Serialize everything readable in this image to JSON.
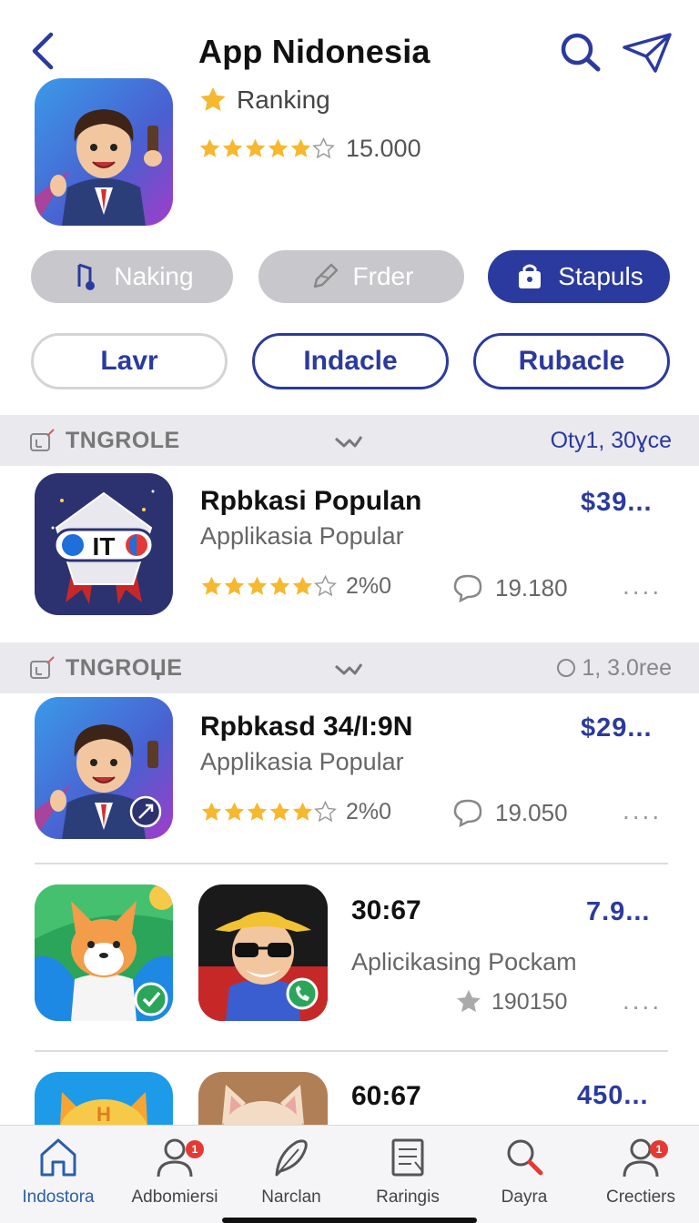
{
  "header": {
    "title": "App Nidonesia",
    "ranking_label": "Ranking",
    "rating_count": "15.000"
  },
  "filters_primary": [
    {
      "label": "Naking",
      "icon": "music-note-icon"
    },
    {
      "label": "Frder",
      "icon": "pen-icon"
    },
    {
      "label": "Stapuls",
      "icon": "bag-icon"
    }
  ],
  "filters_secondary": [
    {
      "label": "Lavr"
    },
    {
      "label": "Indacle"
    },
    {
      "label": "Rubacle"
    }
  ],
  "sections": [
    {
      "label": "TNGROLE",
      "right": "Oty1, 30ɣce"
    },
    {
      "label": "TNGROЏE",
      "right": "1, 3.0ree"
    }
  ],
  "items": [
    {
      "title": "Rpbkasi Populan",
      "subtitle": "Applikasia Popular",
      "price": "$39...",
      "rating": "2%0",
      "comments": "19.180",
      "more": "...."
    },
    {
      "title": "Rpbkasd 34/I:9N",
      "subtitle": "Applikasia  Popular",
      "price": "$29...",
      "rating": "2%0",
      "comments": "19.050",
      "more": "...."
    },
    {
      "title": "30:67",
      "subtitle": "Aplicikasing Pockam",
      "price": "7.9...",
      "count": "190150",
      "more": "...."
    },
    {
      "title": "60:67",
      "price": "450..."
    }
  ],
  "bottom_nav": [
    {
      "label": "Indostora",
      "icon": "home-icon",
      "active": true
    },
    {
      "label": "Adbomiersi",
      "icon": "user-icon",
      "badge": "1"
    },
    {
      "label": "Narclan",
      "icon": "feather-icon"
    },
    {
      "label": "Raringis",
      "icon": "document-icon"
    },
    {
      "label": "Dayra",
      "icon": "search-icon"
    },
    {
      "label": "Crectiers",
      "icon": "user-icon",
      "badge": "1"
    }
  ],
  "colors": {
    "accent": "#2b3a9e",
    "star": "#f5b82e",
    "section_bg": "#e9e9ee"
  }
}
